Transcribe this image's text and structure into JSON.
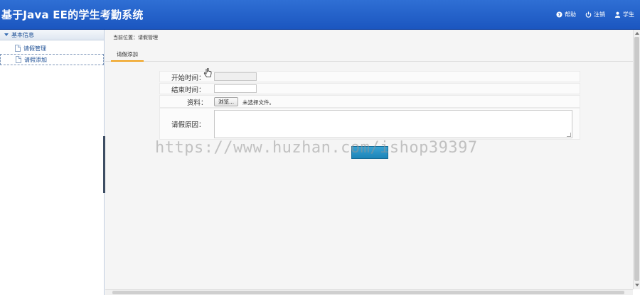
{
  "app": {
    "title": "基于Java EE的学生考勤系统"
  },
  "top_links": [
    {
      "label": "帮助",
      "icon": "help-icon"
    },
    {
      "label": "注销",
      "icon": "power-icon"
    },
    {
      "label": "学生",
      "icon": "user-icon"
    }
  ],
  "sidebar": {
    "group_label": "基本信息",
    "items": [
      {
        "label": "请假管理",
        "icon": "document-icon"
      },
      {
        "label": "请假添加",
        "icon": "document-icon"
      }
    ]
  },
  "main": {
    "breadcrumb": "当前位置：请假管理",
    "tab": "请假添加"
  },
  "form": {
    "start_label": "开始时间：",
    "end_label": "结束时间：",
    "file_label": "资料：",
    "file_button": "浏览...",
    "file_status": "未选择文件。",
    "reason_label": "请假原因：",
    "submit_label": ""
  },
  "watermark": "https://www.huzhan.com/ishop39397",
  "colors": {
    "header": "#1b56c0",
    "tab_accent": "#f0a01a",
    "submit": "#2792c6"
  }
}
